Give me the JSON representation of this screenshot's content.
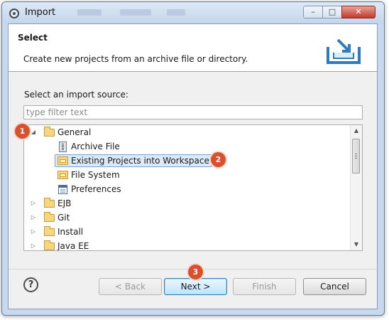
{
  "window": {
    "title": "Import",
    "controls": {
      "minimize": "–",
      "maximize": "□",
      "close": "✕"
    }
  },
  "header": {
    "title": "Select",
    "description": "Create new projects from an archive file or directory.",
    "icon": "import-wizard-icon"
  },
  "source": {
    "label": "Select an import source:",
    "filter_placeholder": "type filter text"
  },
  "tree": {
    "items": [
      {
        "label": "General",
        "expanded": true,
        "icon": "folder-icon",
        "level": 0
      },
      {
        "label": "Archive File",
        "icon": "archive-icon",
        "level": 1
      },
      {
        "label": "Existing Projects into Workspace",
        "icon": "project-folder-icon",
        "level": 1,
        "selected": true
      },
      {
        "label": "File System",
        "icon": "file-system-icon",
        "level": 1
      },
      {
        "label": "Preferences",
        "icon": "preferences-icon",
        "level": 1
      },
      {
        "label": "EJB",
        "expanded": false,
        "icon": "folder-icon",
        "level": 0
      },
      {
        "label": "Git",
        "expanded": false,
        "icon": "folder-icon",
        "level": 0
      },
      {
        "label": "Install",
        "expanded": false,
        "icon": "folder-icon",
        "level": 0
      },
      {
        "label": "Java EE",
        "expanded": false,
        "icon": "folder-icon",
        "level": 0
      }
    ]
  },
  "buttons": {
    "help": "?",
    "back": "< Back",
    "next": "Next >",
    "finish": "Finish",
    "cancel": "Cancel"
  },
  "annotations": {
    "badge1": "1",
    "badge2": "2",
    "badge3": "3",
    "color": "#d9502f"
  },
  "colors": {
    "titlebar": "#c7d9ef",
    "selection": "#dce9f7",
    "primary_button": "#bee6fd"
  }
}
